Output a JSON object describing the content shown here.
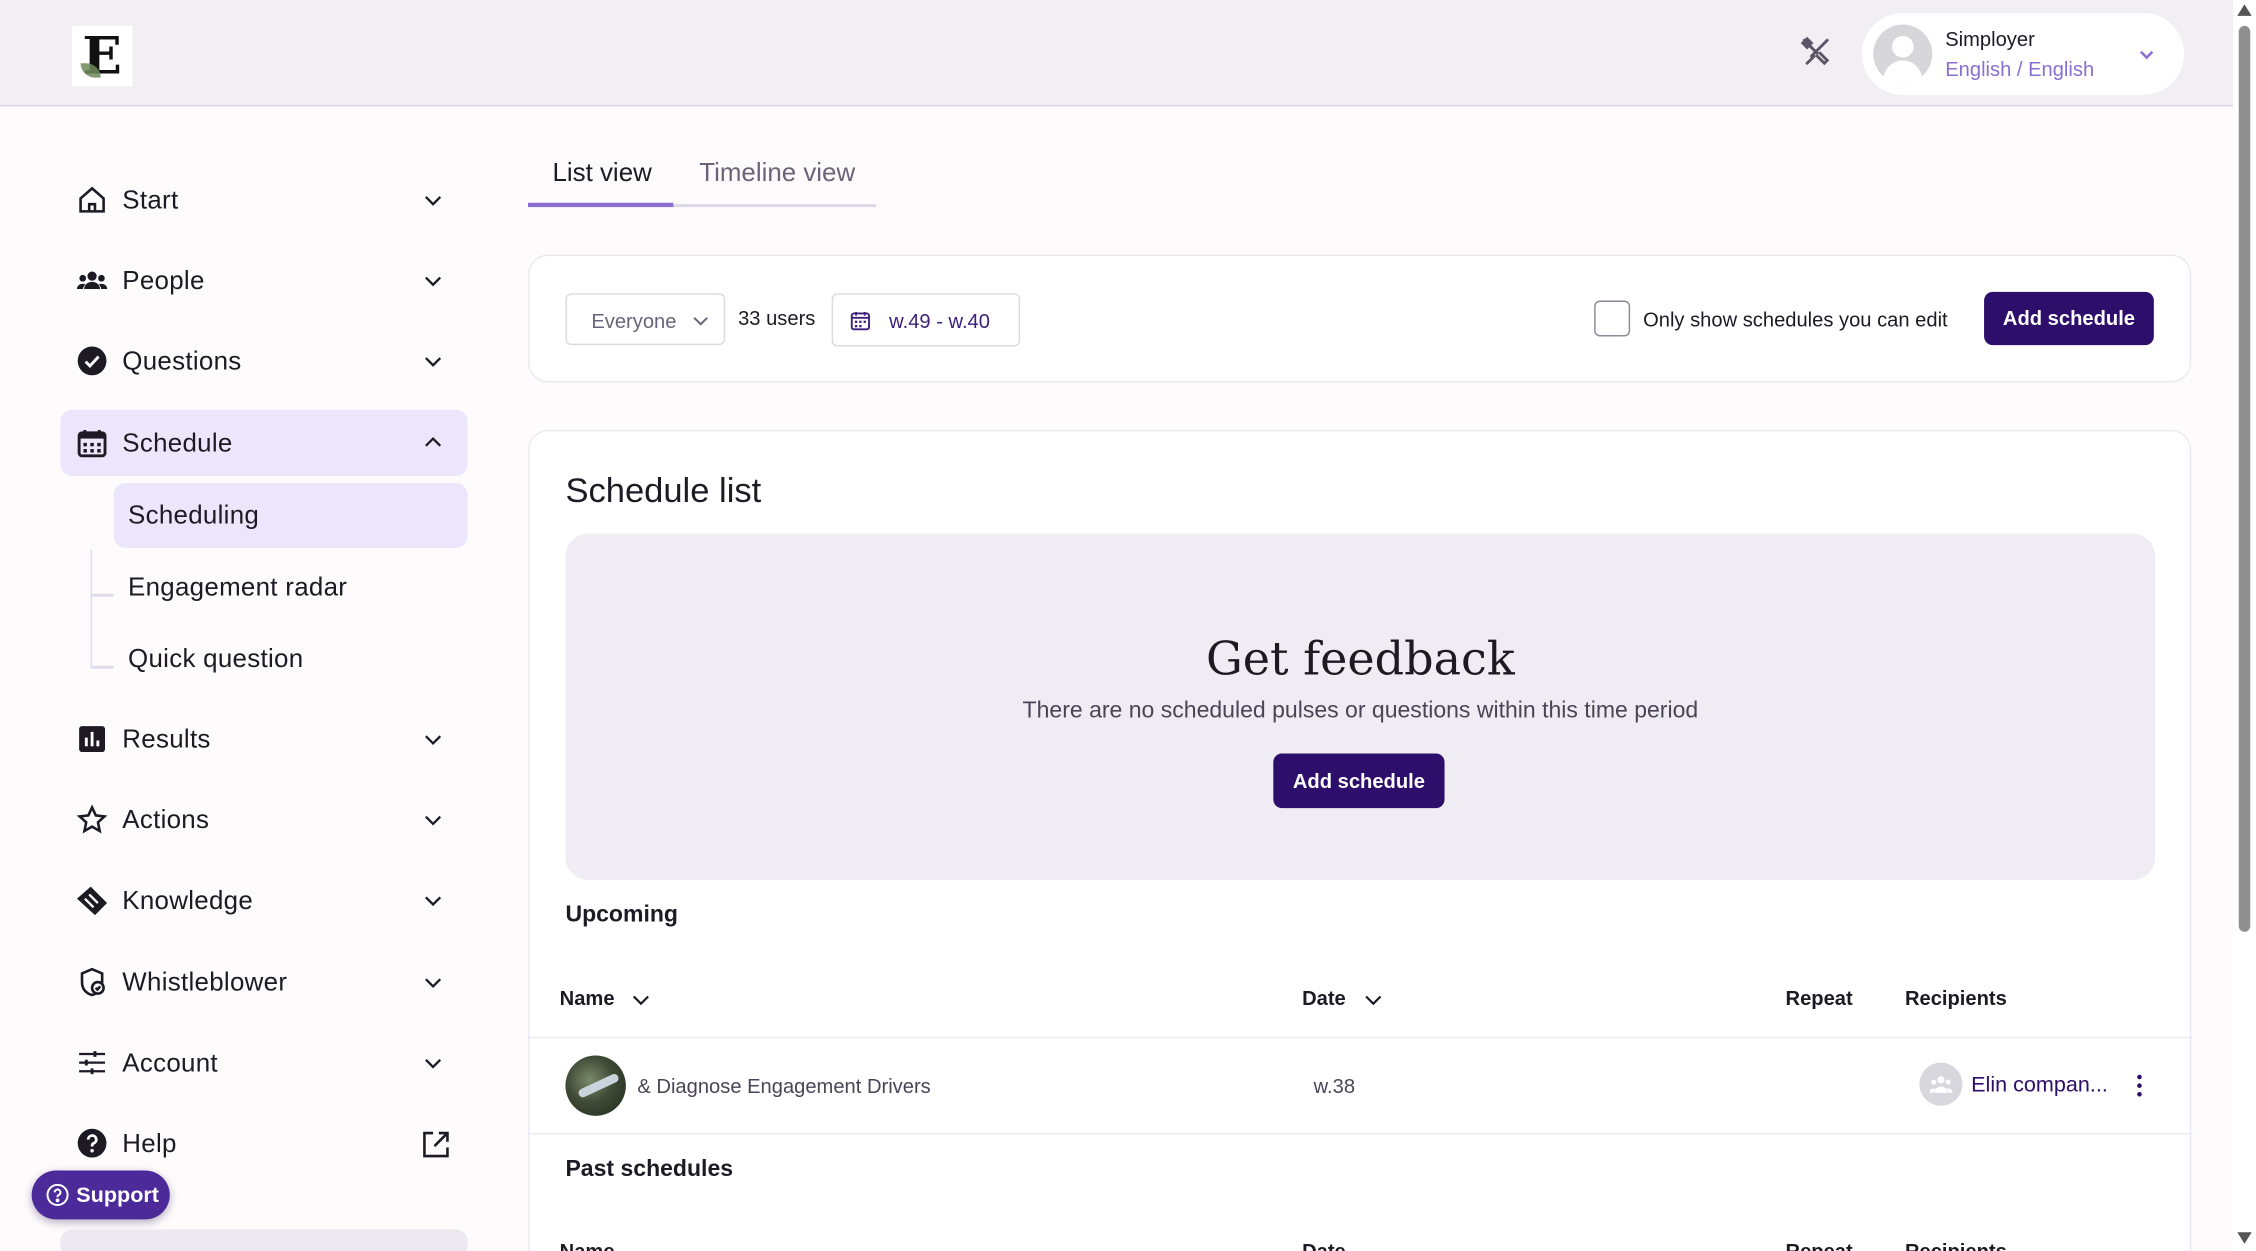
{
  "header": {
    "logo_letter": "E",
    "user": {
      "name": "Simployer",
      "language": "English / English"
    }
  },
  "sidebar": {
    "items": [
      {
        "label": "Start",
        "icon": "home-icon"
      },
      {
        "label": "People",
        "icon": "people-icon"
      },
      {
        "label": "Questions",
        "icon": "check-circle-icon"
      },
      {
        "label": "Schedule",
        "icon": "calendar-icon",
        "expanded": true
      },
      {
        "label": "Results",
        "icon": "bar-chart-icon"
      },
      {
        "label": "Actions",
        "icon": "star-icon"
      },
      {
        "label": "Knowledge",
        "icon": "knowledge-icon"
      },
      {
        "label": "Whistleblower",
        "icon": "whistleblower-icon"
      },
      {
        "label": "Account",
        "icon": "sliders-icon"
      },
      {
        "label": "Help",
        "icon": "help-icon"
      }
    ],
    "schedule_subitems": [
      {
        "label": "Scheduling",
        "active": true
      },
      {
        "label": "Engagement radar"
      },
      {
        "label": "Quick question"
      }
    ],
    "support_label": "Support"
  },
  "tabs": [
    {
      "label": "List view",
      "active": true
    },
    {
      "label": "Timeline view"
    }
  ],
  "filters": {
    "group_select": "Everyone",
    "users_count": "33 users",
    "date_range": "w.49 - w.40",
    "only_editable_label": "Only show schedules you can edit",
    "only_editable_checked": false,
    "add_schedule_label": "Add schedule"
  },
  "schedule_list": {
    "title": "Schedule list",
    "empty": {
      "title": "Get feedback",
      "subtitle": "There are no scheduled pulses or questions within this time period",
      "button_label": "Add schedule"
    },
    "upcoming": {
      "title": "Upcoming",
      "columns": {
        "name": "Name",
        "date": "Date",
        "repeat": "Repeat",
        "recipients": "Recipients"
      },
      "rows": [
        {
          "name": "& Diagnose Engagement Drivers",
          "date": "w.38",
          "repeat": "",
          "recipients": "Elin compan..."
        }
      ]
    },
    "past": {
      "title": "Past schedules",
      "columns": {
        "name": "Name",
        "date": "Date",
        "repeat": "Repeat",
        "recipients": "Recipients"
      }
    }
  },
  "colors": {
    "brand_dark": "#2d0e6b",
    "accent": "#8a6fd1",
    "active_bg": "#ebe6fb",
    "support": "#4c2a9a"
  }
}
